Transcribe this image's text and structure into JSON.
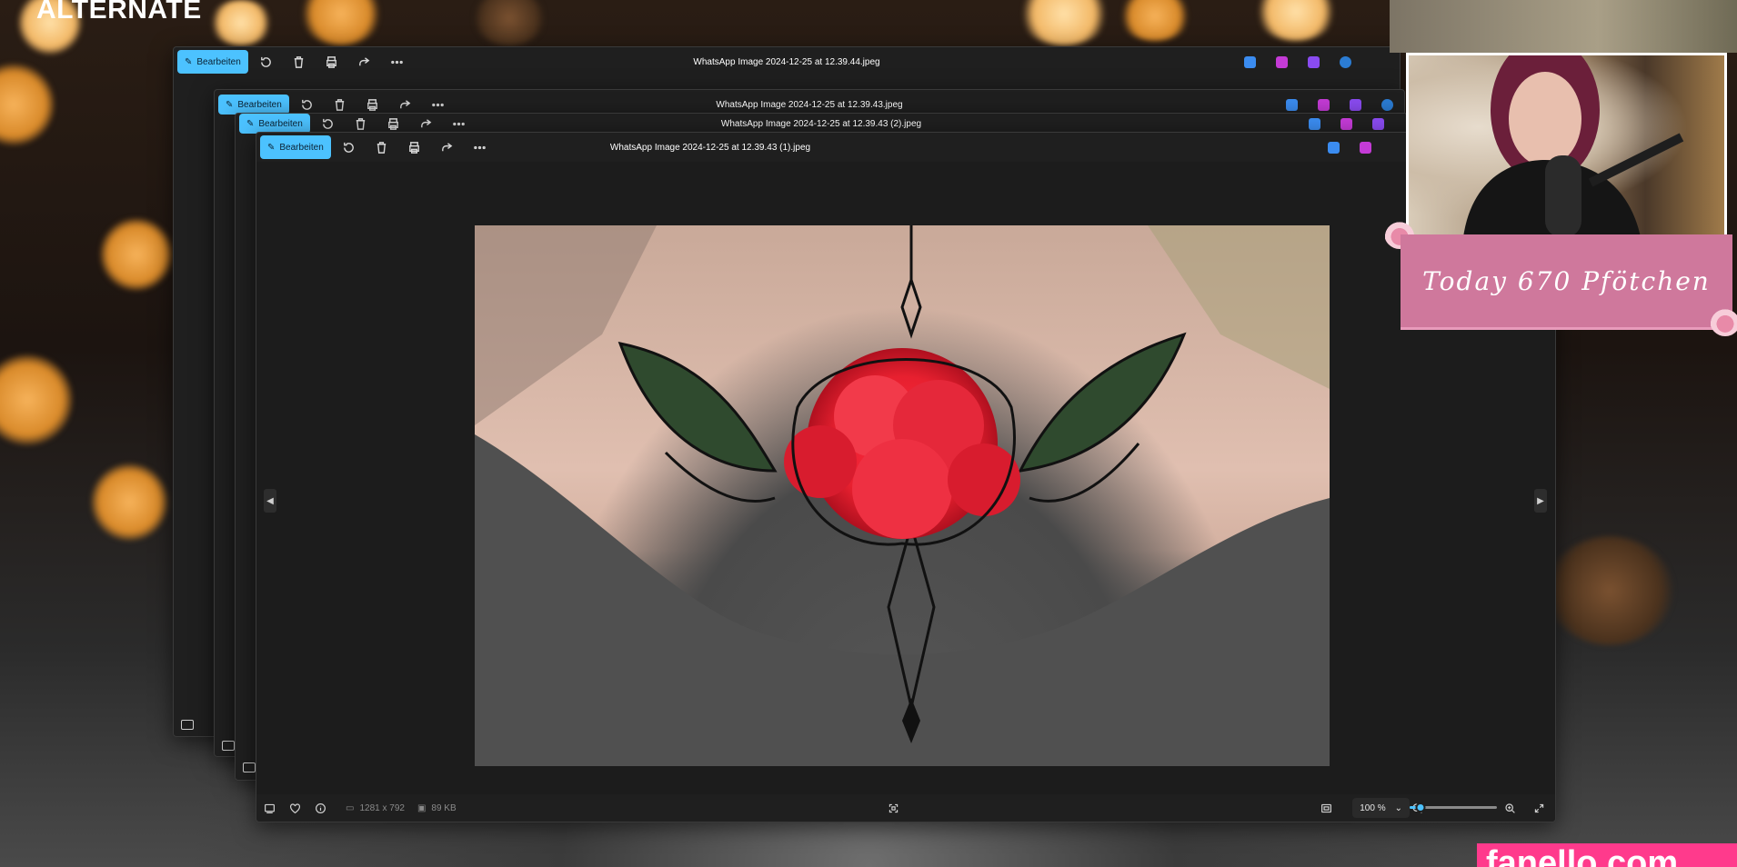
{
  "overlay": {
    "brand_logo": "ALTERNATE",
    "counter_text": "Today  670  Pfötchen",
    "watermark": "fanello.com"
  },
  "windows": [
    {
      "title": "WhatsApp Image 2024-12-25 at 12.39.44.jpeg",
      "edit_label": "Bearbeiten"
    },
    {
      "title": "WhatsApp Image 2024-12-25 at 12.39.43.jpeg",
      "edit_label": "Bearbeiten"
    },
    {
      "title": "WhatsApp Image 2024-12-25 at 12.39.43 (2).jpeg",
      "edit_label": "Bearbeiten"
    },
    {
      "title": "WhatsApp Image 2024-12-25 at 12.39.43 (1).jpeg",
      "edit_label": "Bearbeiten"
    }
  ],
  "toolbar_icons": [
    "edit-icon",
    "rotate-icon",
    "delete-icon",
    "print-icon",
    "share-icon",
    "more-icon"
  ],
  "app_icons": [
    {
      "name": "designer-icon",
      "color": "#3b8cf0"
    },
    {
      "name": "clipchamp-icon",
      "color": "#c43bd6"
    },
    {
      "name": "photos-icon",
      "color": "#8a4bf0"
    },
    {
      "name": "onedrive-icon",
      "color": "#2b7cd3"
    }
  ],
  "status": {
    "dimensions": "1281 x 792",
    "file_size": "89 KB",
    "zoom": "100 %",
    "zoom_level_fraction": 0.12
  },
  "colors": {
    "accent": "#4cc2ff",
    "overlay_pink": "#cf789c",
    "watermark_pink": "#ff3a8c"
  }
}
